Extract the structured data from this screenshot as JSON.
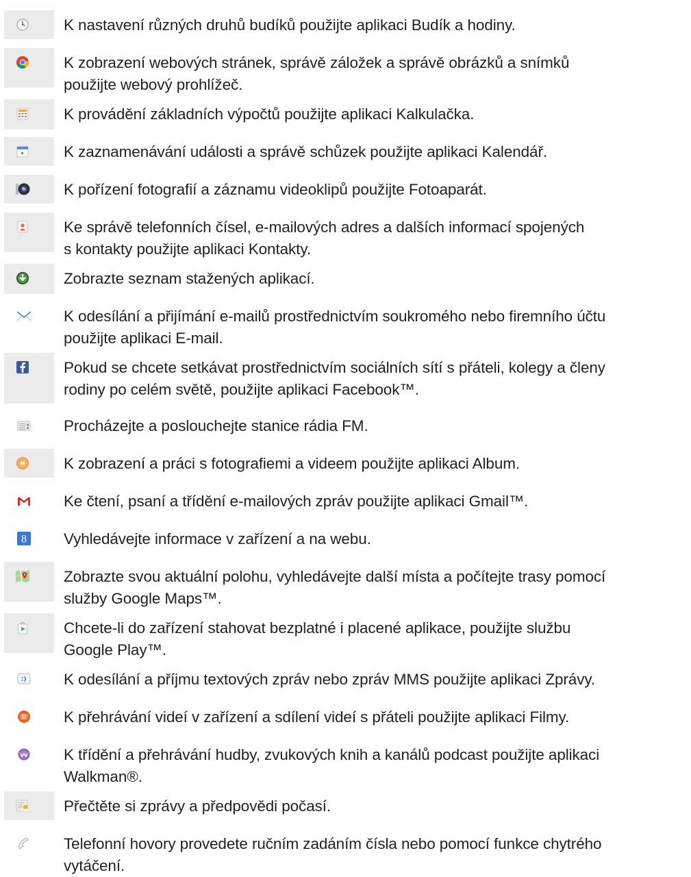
{
  "apps": [
    {
      "icon": "alarm-clock-icon",
      "lines": [
        "K nastavení různých druhů budíků použijte aplikaci Budík a hodiny."
      ]
    },
    {
      "icon": "browser-icon",
      "lines": [
        "K zobrazení webových stránek, správě záložek a správě obrázků a snímků",
        "použijte webový prohlížeč."
      ]
    },
    {
      "icon": "calculator-icon",
      "lines": [
        "K provádění základních výpočtů použijte aplikaci Kalkulačka."
      ]
    },
    {
      "icon": "calendar-icon",
      "lines": [
        "K zaznamenávání události a správě schůzek použijte aplikaci Kalendář."
      ]
    },
    {
      "icon": "camera-icon",
      "lines": [
        "K pořízení fotografií a záznamu videoklipů použijte Fotoaparát."
      ]
    },
    {
      "icon": "contacts-icon",
      "lines": [
        "Ke správě telefonních čísel, e-mailových adres a dalších informací spojených",
        "s kontakty použijte aplikaci Kontakty."
      ]
    },
    {
      "icon": "download-icon",
      "lines": [
        "Zobrazte seznam stažených aplikací."
      ]
    },
    {
      "icon": "email-icon",
      "lines": [
        "K odesílání a přijímání e-mailů prostřednictvím soukromého nebo firemního účtu",
        "použijte aplikaci E-mail."
      ]
    },
    {
      "icon": "facebook-icon",
      "lines": [
        "Pokud se chcete setkávat prostřednictvím sociálních sítí s přáteli, kolegy a členy",
        "rodiny po celém světě, použijte aplikaci Facebook™."
      ]
    },
    {
      "icon": "fm-radio-icon",
      "lines": [
        "Procházejte a poslouchejte stanice rádia FM."
      ]
    },
    {
      "icon": "album-icon",
      "lines": [
        "K zobrazení a práci s fotografiemi a videem použijte aplikaci Album."
      ]
    },
    {
      "icon": "gmail-icon",
      "lines": [
        "Ke čtení, psaní a třídění e-mailových zpráv použijte aplikaci Gmail™."
      ]
    },
    {
      "icon": "google-search-icon",
      "lines": [
        "Vyhledávejte informace v zařízení a na webu."
      ]
    },
    {
      "icon": "maps-icon",
      "lines": [
        "Zobrazte svou aktuální polohu, vyhledávejte další místa a počítejte trasy pomocí",
        "služby Google Maps™."
      ]
    },
    {
      "icon": "play-store-icon",
      "lines": [
        "Chcete-li do zařízení stahovat bezplatné i placené aplikace, použijte službu",
        "Google Play™."
      ]
    },
    {
      "icon": "messaging-icon",
      "lines": [
        "K odesílání a příjmu textových zpráv nebo zpráv MMS použijte aplikaci Zprávy."
      ]
    },
    {
      "icon": "movies-icon",
      "lines": [
        "K přehrávání videí v zařízení a sdílení videí s přáteli použijte aplikaci Filmy."
      ]
    },
    {
      "icon": "walkman-icon",
      "lines": [
        "K třídění a přehrávání hudby, zvukových knih a kanálů podcast použijte aplikaci",
        "Walkman®."
      ]
    },
    {
      "icon": "news-weather-icon",
      "lines": [
        "Přečtěte si zprávy a předpovědi počasí."
      ]
    },
    {
      "icon": "phone-icon",
      "lines": [
        "Telefonní hovory provedete ručním zadáním čísla nebo pomocí funkce chytrého",
        "vytáčení."
      ]
    }
  ]
}
